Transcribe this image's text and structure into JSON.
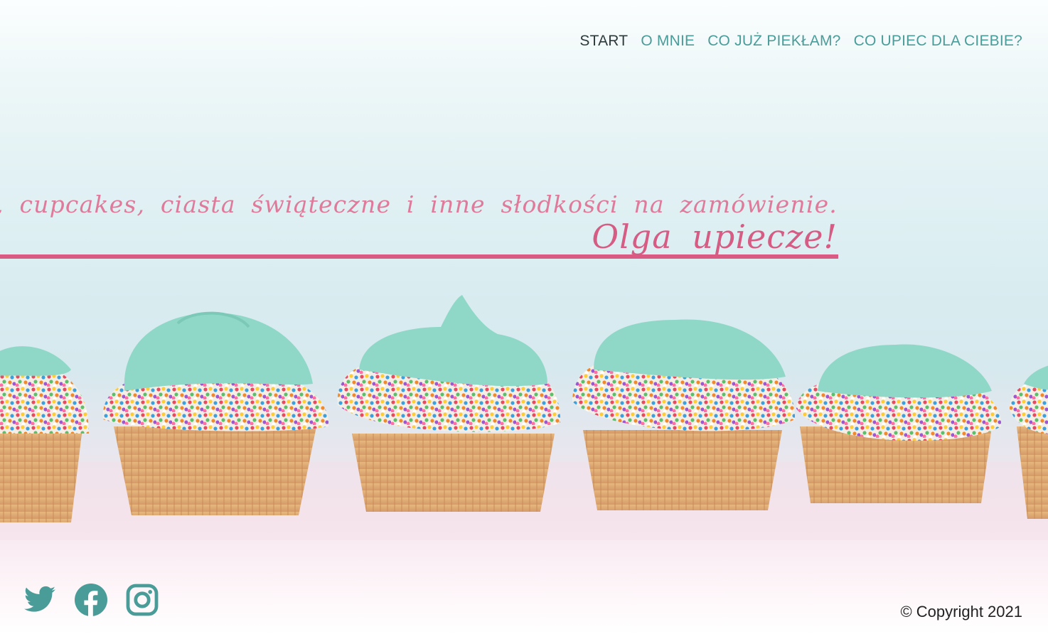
{
  "nav": {
    "items": [
      {
        "label": "START",
        "active": true
      },
      {
        "label": "O MNIE",
        "active": false
      },
      {
        "label": "CO JUŻ PIEKŁAM?",
        "active": false
      },
      {
        "label": "CO UPIEC DLA CIEBIE?",
        "active": false
      }
    ]
  },
  "hero": {
    "tagline": "Torty, ciastka, cupcakes, ciasta świąteczne i inne słodkości na zamówienie.",
    "title": "Olga upiecze!"
  },
  "social": {
    "icons": [
      "twitter-icon",
      "facebook-icon",
      "instagram-icon"
    ],
    "color": "#4a9c98"
  },
  "footer": {
    "copyright": "© Copyright 2021"
  },
  "colors": {
    "accent_pink": "#d95a82",
    "nav_teal": "#4a9c98",
    "nav_active": "#2d3a3a",
    "frosting": "#8fd8c8"
  }
}
